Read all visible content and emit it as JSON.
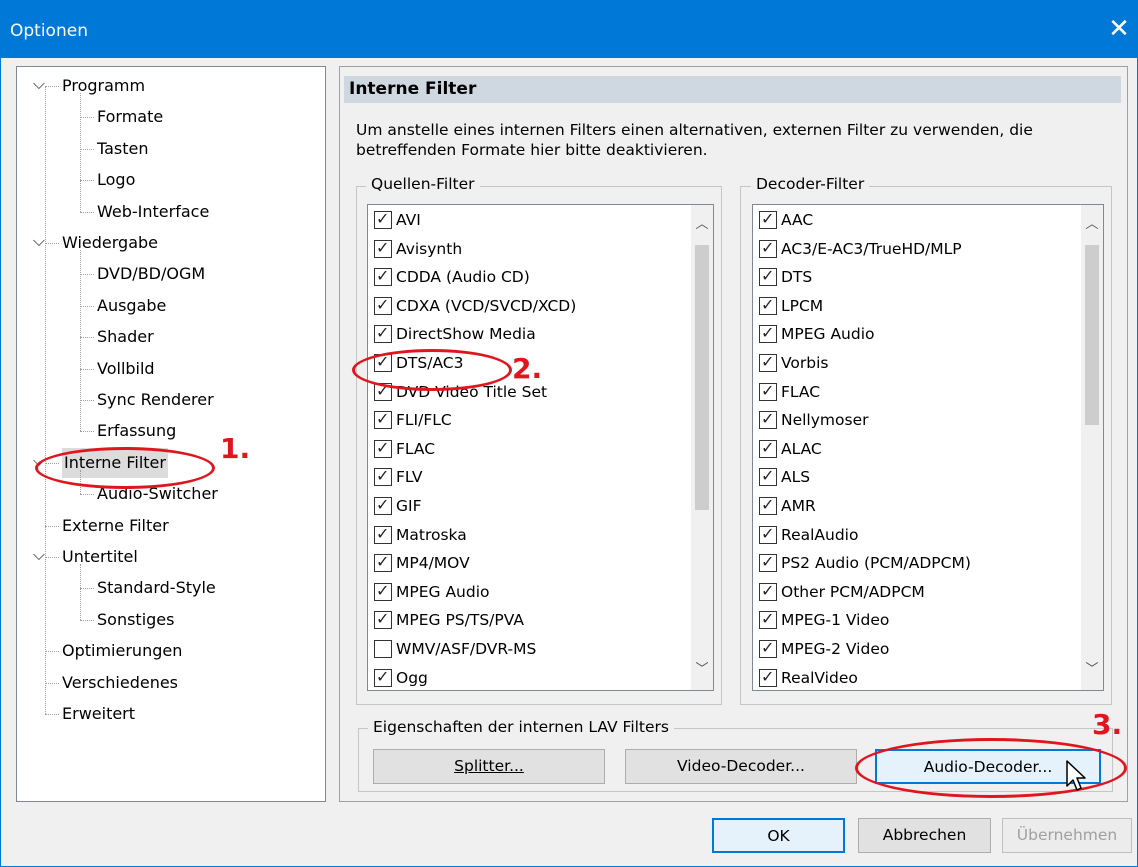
{
  "window": {
    "title": "Optionen",
    "close_glyph": "✕"
  },
  "tree": {
    "items": [
      {
        "label": "Programm",
        "level": 0,
        "expanded": true
      },
      {
        "label": "Formate",
        "level": 1
      },
      {
        "label": "Tasten",
        "level": 1
      },
      {
        "label": "Logo",
        "level": 1
      },
      {
        "label": "Web-Interface",
        "level": 1
      },
      {
        "label": "Wiedergabe",
        "level": 0,
        "expanded": true
      },
      {
        "label": "DVD/BD/OGM",
        "level": 1
      },
      {
        "label": "Ausgabe",
        "level": 1
      },
      {
        "label": "Shader",
        "level": 1
      },
      {
        "label": "Vollbild",
        "level": 1
      },
      {
        "label": "Sync Renderer",
        "level": 1
      },
      {
        "label": "Erfassung",
        "level": 1
      },
      {
        "label": "Interne Filter",
        "level": 0,
        "expanded": true,
        "selected": true
      },
      {
        "label": "Audio-Switcher",
        "level": 1
      },
      {
        "label": "Externe Filter",
        "level": 0
      },
      {
        "label": "Untertitel",
        "level": 0,
        "expanded": true
      },
      {
        "label": "Standard-Style",
        "level": 1
      },
      {
        "label": "Sonstiges",
        "level": 1
      },
      {
        "label": "Optimierungen",
        "level": 0
      },
      {
        "label": "Verschiedenes",
        "level": 0
      },
      {
        "label": "Erweitert",
        "level": 0
      }
    ]
  },
  "panel": {
    "title": "Interne Filter",
    "description": "Um anstelle eines internen Filters einen alternativen, externen Filter zu verwenden, die betreffenden Formate hier bitte deaktivieren."
  },
  "source_filters": {
    "legend": "Quellen-Filter",
    "items": [
      {
        "label": "AVI",
        "checked": true
      },
      {
        "label": "Avisynth",
        "checked": true
      },
      {
        "label": "CDDA (Audio CD)",
        "checked": true
      },
      {
        "label": "CDXA (VCD/SVCD/XCD)",
        "checked": true
      },
      {
        "label": "DirectShow Media",
        "checked": true
      },
      {
        "label": "DTS/AC3",
        "checked": true
      },
      {
        "label": "DVD Video Title Set",
        "checked": true
      },
      {
        "label": "FLI/FLC",
        "checked": true
      },
      {
        "label": "FLAC",
        "checked": true
      },
      {
        "label": "FLV",
        "checked": true
      },
      {
        "label": "GIF",
        "checked": true
      },
      {
        "label": "Matroska",
        "checked": true
      },
      {
        "label": "MP4/MOV",
        "checked": true
      },
      {
        "label": "MPEG Audio",
        "checked": true
      },
      {
        "label": "MPEG PS/TS/PVA",
        "checked": true
      },
      {
        "label": "WMV/ASF/DVR-MS",
        "checked": false
      },
      {
        "label": "Ogg",
        "checked": true
      }
    ]
  },
  "decoder_filters": {
    "legend": "Decoder-Filter",
    "items": [
      {
        "label": "AAC",
        "checked": true
      },
      {
        "label": "AC3/E-AC3/TrueHD/MLP",
        "checked": true
      },
      {
        "label": "DTS",
        "checked": true
      },
      {
        "label": "LPCM",
        "checked": true
      },
      {
        "label": "MPEG Audio",
        "checked": true
      },
      {
        "label": "Vorbis",
        "checked": true
      },
      {
        "label": "FLAC",
        "checked": true
      },
      {
        "label": "Nellymoser",
        "checked": true
      },
      {
        "label": "ALAC",
        "checked": true
      },
      {
        "label": "ALS",
        "checked": true
      },
      {
        "label": "AMR",
        "checked": true
      },
      {
        "label": "RealAudio",
        "checked": true
      },
      {
        "label": "PS2 Audio (PCM/ADPCM)",
        "checked": true
      },
      {
        "label": "Other PCM/ADPCM",
        "checked": true
      },
      {
        "label": "MPEG-1 Video",
        "checked": true
      },
      {
        "label": "MPEG-2 Video",
        "checked": true
      },
      {
        "label": "RealVideo",
        "checked": true
      }
    ]
  },
  "lav": {
    "legend": "Eigenschaften der internen LAV Filters",
    "splitter_label": "Splitter...",
    "video_decoder_label": "Video-Decoder...",
    "audio_decoder_label": "Audio-Decoder..."
  },
  "footer": {
    "ok_label": "OK",
    "cancel_label": "Abbrechen",
    "apply_label": "Übernehmen"
  },
  "annotations": {
    "step1": "1.",
    "step2": "2.",
    "step3": "3.",
    "color": "#e0161f"
  },
  "icons": {
    "scroll_up": "chevron-up-icon",
    "scroll_down": "chevron-down-icon",
    "tree_expand": "chevron-down-icon",
    "check": "check-icon",
    "cursor": "mouse-pointer-icon"
  }
}
